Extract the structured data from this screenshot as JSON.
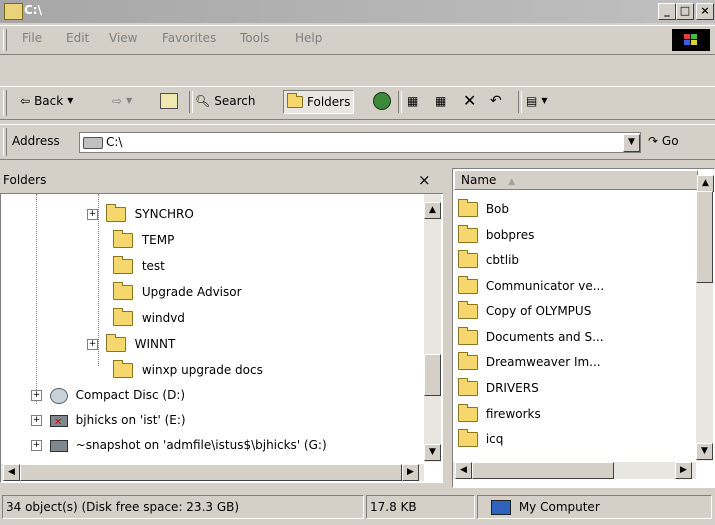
{
  "window": {
    "title": "C:\\",
    "buttons": [
      "_",
      "□",
      "×"
    ]
  },
  "menu": [
    "File",
    "Edit",
    "View",
    "Favorites",
    "Tools",
    "Help"
  ],
  "toolbar": {
    "back": "Back",
    "search": "Search",
    "folders": "Folders"
  },
  "address": {
    "label": "Address",
    "value": "C:\\",
    "go": "Go"
  },
  "folders_pane": {
    "title": "Folders",
    "close": "×",
    "items": [
      "SYNCHRO",
      "TEMP",
      "test",
      "Upgrade Advisor",
      "windvd",
      "WINNT",
      "winxp upgrade docs",
      "Compact Disc (D:)",
      "bjhicks on 'ist' (E:)",
      "~snapshot on 'admfile\\istus$\\bjhicks' (G:)"
    ]
  },
  "file_list": {
    "column": "Name",
    "sort_indicator": "▲",
    "items": [
      "Bob",
      "bobpres",
      "cbtlib",
      "Communicator ve...",
      "Copy of OLYMPUS",
      "Documents and S...",
      "Dreamweaver Im...",
      "DRIVERS",
      "fireworks",
      "icq"
    ]
  },
  "status": {
    "objects": "34 object(s) (Disk free space: 23.3 GB)",
    "size": "17.8 KB",
    "location": "My Computer"
  }
}
